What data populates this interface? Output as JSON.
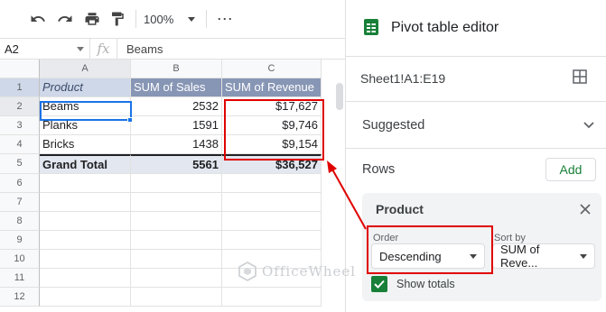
{
  "toolbar": {
    "zoom": "100%",
    "icons": [
      "undo-icon",
      "redo-icon",
      "print-icon",
      "paint-format-icon",
      "chevron-down-icon",
      "more-icon"
    ]
  },
  "formula_bar": {
    "name_box": "A2",
    "fx": "fx",
    "value": "Beams"
  },
  "columns": [
    "A",
    "B",
    "C"
  ],
  "rows": [
    "1",
    "2",
    "3",
    "4",
    "5",
    "6",
    "7",
    "8",
    "9",
    "10",
    "11",
    "12"
  ],
  "table": {
    "headers": [
      "Product",
      "SUM of Sales",
      "SUM of Revenue"
    ],
    "data": [
      [
        "Beams",
        "2532",
        "$17,627"
      ],
      [
        "Planks",
        "1591",
        "$9,746"
      ],
      [
        "Bricks",
        "1438",
        "$9,154"
      ]
    ],
    "total": [
      "Grand Total",
      "5561",
      "$36,527"
    ]
  },
  "panel": {
    "title": "Pivot table editor",
    "range": "Sheet1!A1:E19",
    "suggested": "Suggested",
    "rows_label": "Rows",
    "add_label": "Add",
    "card": {
      "title": "Product",
      "order_label": "Order",
      "order_value": "Descending",
      "sort_label": "Sort by",
      "sort_value": "SUM of Reve...",
      "show_totals": "Show totals",
      "show_totals_checked": true
    }
  },
  "watermark": "OfficeWheel",
  "colors": {
    "accent_green": "#188038",
    "selection_blue": "#1a73e8",
    "highlight_red": "#e00000",
    "header_dark": "#8796b5",
    "header_light": "#cfd8e8"
  }
}
